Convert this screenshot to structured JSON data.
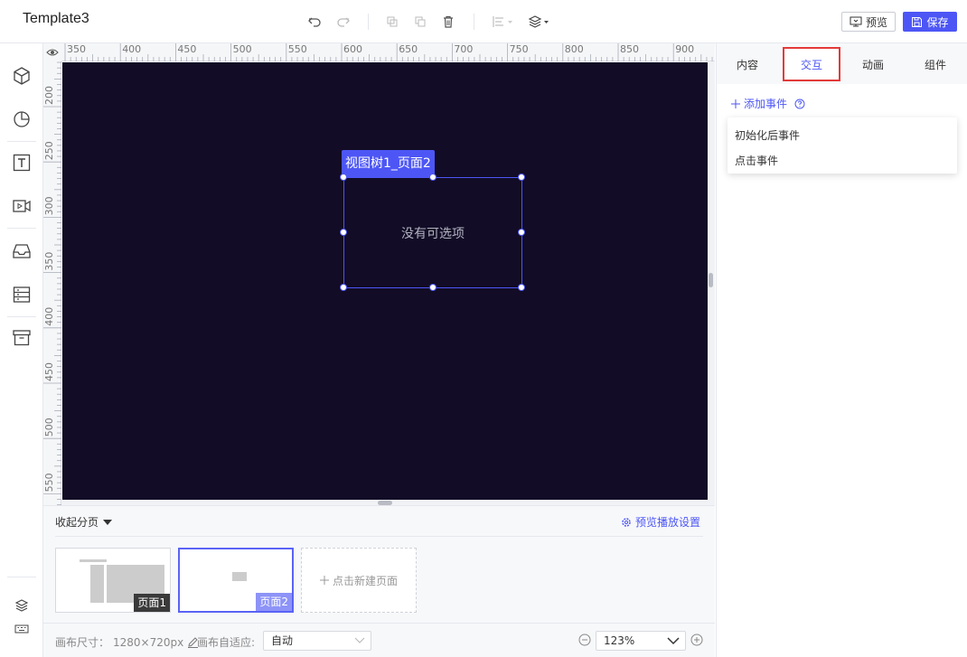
{
  "app": {
    "title": "Template3"
  },
  "toolbar": {
    "undo_icon": "undo-icon",
    "redo_icon": "redo-icon",
    "copy_icon": "copy-icon",
    "paste_icon": "paste-icon",
    "delete_icon": "trash-icon",
    "align_icon": "align-icon",
    "layer_icon": "layers-icon",
    "preview_label": "预览",
    "save_label": "保存",
    "accent_color": "#4d56f5"
  },
  "sidebar": {
    "items": [
      {
        "icon": "cube-icon"
      },
      {
        "icon": "pie-chart-icon"
      },
      {
        "icon": "text-icon"
      },
      {
        "icon": "video-icon"
      },
      {
        "icon": "inbox-icon"
      },
      {
        "icon": "list-icon"
      },
      {
        "icon": "archive-icon"
      }
    ],
    "bottom": [
      {
        "icon": "layers-icon"
      },
      {
        "icon": "keyboard-icon"
      }
    ]
  },
  "ruler": {
    "top_labels": [
      "350",
      "400",
      "450",
      "500",
      "550",
      "600",
      "650",
      "700",
      "750",
      "800",
      "850",
      "900"
    ],
    "left_labels": [
      "200",
      "250",
      "300",
      "350",
      "400",
      "450",
      "500",
      "550"
    ]
  },
  "canvas": {
    "background": "#120c26",
    "selection": {
      "label": "视图树1_页面2",
      "placeholder": "没有可选项"
    }
  },
  "pages": {
    "collapse_label": "收起分页",
    "preview_settings_label": "预览播放设置",
    "items": [
      {
        "label": "页面1",
        "active": false
      },
      {
        "label": "页面2",
        "active": true
      }
    ],
    "new_page_label": "点击新建页面"
  },
  "footer": {
    "canvas_size_label": "画布尺寸：",
    "canvas_size_value": "1280×720px",
    "fit_label": "画布自适应:",
    "fit_value": "自动",
    "zoom_value": "123%"
  },
  "right_panel": {
    "tabs": [
      {
        "label": "内容",
        "active": false
      },
      {
        "label": "交互",
        "active": true
      },
      {
        "label": "动画",
        "active": false
      },
      {
        "label": "组件",
        "active": false
      }
    ],
    "add_event_label": "添加事件",
    "events": [
      "初始化后事件",
      "点击事件"
    ]
  }
}
